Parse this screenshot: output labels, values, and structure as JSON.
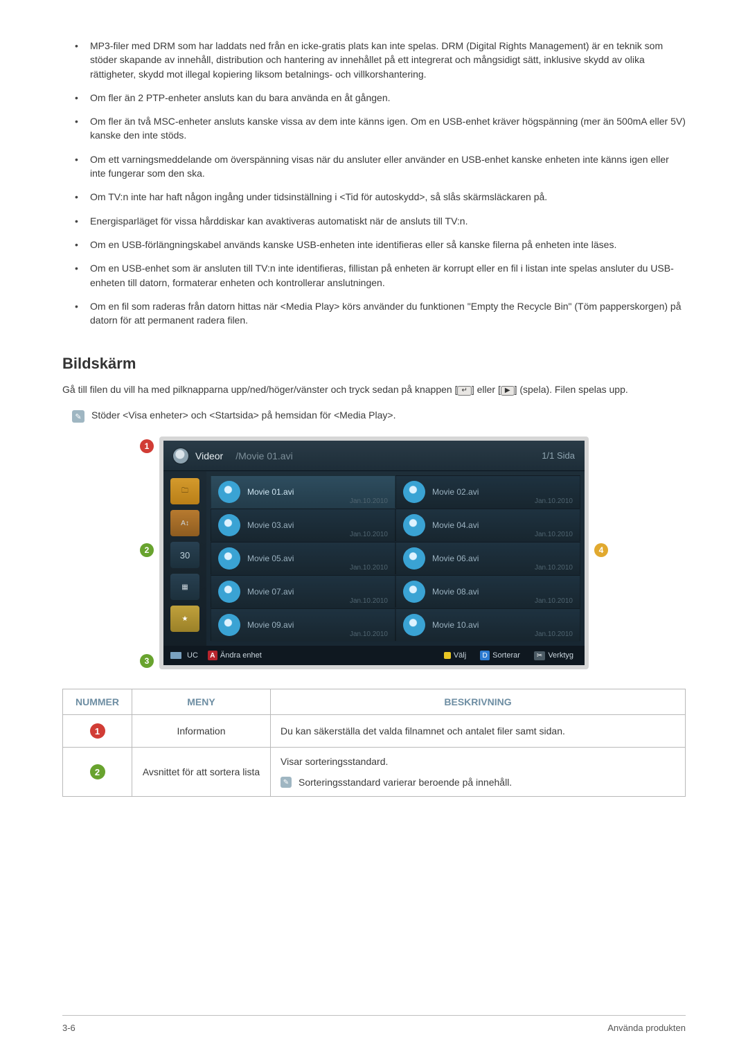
{
  "bullets": [
    "MP3-filer med DRM som har laddats ned från en icke-gratis plats kan inte spelas. DRM (Digital Rights Management) är en teknik som stöder skapande av innehåll, distribution och hantering av innehållet på ett integrerat och mångsidigt sätt, inklusive skydd av olika rättigheter, skydd mot illegal kopiering liksom betalnings- och villkorshantering.",
    "Om fler än 2 PTP-enheter ansluts kan du bara använda en åt gången.",
    "Om fler än två MSC-enheter ansluts kanske vissa av dem inte känns igen. Om en USB-enhet kräver högspänning (mer än 500mA eller 5V) kanske den inte stöds.",
    "Om ett varningsmeddelande om överspänning visas när du ansluter eller använder en USB-enhet kanske enheten inte känns igen eller inte fungerar som den ska.",
    "Om TV:n inte har haft någon ingång under tidsinställning i <Tid för autoskydd>, så slås skärmsläckaren på.",
    "Energisparläget för vissa hårddiskar kan avaktiveras automatiskt när de ansluts till TV:n.",
    "Om en USB-förlängningskabel används kanske USB-enheten inte identifieras eller så kanske filerna på enheten inte läses.",
    "Om en USB-enhet som är ansluten till TV:n inte identifieras, fillistan på enheten är korrupt eller en fil i listan inte spelas ansluter du USB-enheten till datorn, formaterar enheten och kontrollerar anslutningen.",
    "Om en fil som raderas från datorn hittas när <Media Play> körs använder du funktionen \"Empty the Recycle Bin\" (Töm papperskorgen) på datorn för att permanent radera filen."
  ],
  "section_title": "Bildskärm",
  "intro_pre": "Gå till filen du vill ha med pilknapparna upp/ned/höger/vänster och tryck sedan på knappen [",
  "intro_mid": "] eller [",
  "intro_post": "] (spela). Filen spelas upp.",
  "icon_enter_glyph": "↵",
  "icon_play_glyph": "▶",
  "note_line": "Stöder <Visa enheter> och <Startsida> på hemsidan för <Media Play>.",
  "screenshot": {
    "breadcrumb_title": "Videor",
    "breadcrumb_file": "/Movie 01.avi",
    "page_indicator": "1/1 Sida",
    "sidebar_num": "30",
    "files": [
      {
        "name": "Movie 01.avi",
        "date": "Jan.10.2010",
        "selected": true
      },
      {
        "name": "Movie 02.avi",
        "date": "Jan.10.2010",
        "selected": false
      },
      {
        "name": "Movie 03.avi",
        "date": "Jan.10.2010",
        "selected": false
      },
      {
        "name": "Movie 04.avi",
        "date": "Jan.10.2010",
        "selected": false
      },
      {
        "name": "Movie 05.avi",
        "date": "Jan.10.2010",
        "selected": false
      },
      {
        "name": "Movie 06.avi",
        "date": "Jan.10.2010",
        "selected": false
      },
      {
        "name": "Movie 07.avi",
        "date": "Jan.10.2010",
        "selected": false
      },
      {
        "name": "Movie 08.avi",
        "date": "Jan.10.2010",
        "selected": false
      },
      {
        "name": "Movie 09.avi",
        "date": "Jan.10.2010",
        "selected": false
      },
      {
        "name": "Movie 10.avi",
        "date": "Jan.10.2010",
        "selected": false
      }
    ],
    "footer": {
      "device": "UC",
      "a_label": "Ändra enhet",
      "c_label": "Välj",
      "d_label": "Sorterar",
      "tool_label": "Verktyg",
      "tool_prefix": "✂"
    },
    "callouts": {
      "c1": "1",
      "c2": "2",
      "c3": "3",
      "c4": "4"
    }
  },
  "table": {
    "headers": {
      "num": "NUMMER",
      "menu": "MENY",
      "desc": "BESKRIVNING"
    },
    "rows": [
      {
        "num": "1",
        "badge_class": "nb1",
        "menu": "Information",
        "desc": "Du kan säkerställa det valda filnamnet och antalet filer samt sidan.",
        "note": null
      },
      {
        "num": "2",
        "badge_class": "nb2",
        "menu": "Avsnittet för att sortera lista",
        "desc": "Visar sorteringsstandard.",
        "note": "Sorteringsstandard varierar beroende på innehåll."
      }
    ]
  },
  "footer": {
    "left": "3-6",
    "right": "Använda produkten"
  }
}
